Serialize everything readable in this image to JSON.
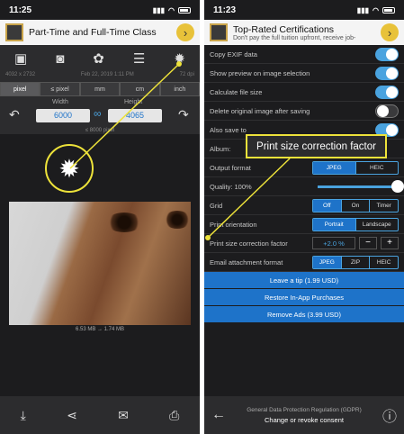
{
  "left": {
    "status": {
      "time": "11:25"
    },
    "ad": {
      "title": "Part-Time and Full-Time Class",
      "go": "›"
    },
    "toolbar": [
      "photos-icon",
      "camera-icon",
      "palette-icon",
      "sliders-icon",
      "gear-icon"
    ],
    "info": {
      "dims": "4032 x 2732",
      "date": "Feb 22, 2019 1:11 PM",
      "dpi": "72 dpi"
    },
    "units": [
      "pixel",
      "≤ pixel",
      "mm",
      "cm",
      "inch"
    ],
    "selected_unit": "pixel",
    "width_label": "Width",
    "height_label": "Height",
    "width_value": "6000",
    "height_value": "4065",
    "max_note": "≤ 8000 pixel",
    "size_info": "6.53 MB → 1.74 MB"
  },
  "right": {
    "status": {
      "time": "11:23"
    },
    "ad": {
      "title": "Top-Rated Certifications",
      "subtitle": "Don't pay the full tuition upfront, receive job-",
      "go": "›"
    },
    "rows": [
      {
        "label": "Copy EXIF data",
        "toggle": true
      },
      {
        "label": "Show preview on image selection",
        "toggle": true
      },
      {
        "label": "Calculate file size",
        "toggle": true
      },
      {
        "label": "Delete original image after saving",
        "toggle": false
      },
      {
        "label": "Also save to",
        "toggle": true
      },
      {
        "label": "Album:"
      }
    ],
    "output_format": {
      "label": "Output format",
      "options": [
        "JPEG",
        "HEIC"
      ],
      "selected": "JPEG"
    },
    "quality": {
      "label": "Quality: 100%",
      "value": 1.0
    },
    "grid": {
      "label": "Grid",
      "options": [
        "Off",
        "On",
        "Timer"
      ],
      "selected": "Off"
    },
    "print_orientation": {
      "label": "Print orientation",
      "options": [
        "Portrait",
        "Landscape"
      ],
      "selected": "Portrait"
    },
    "print_correction": {
      "label": "Print size correction factor",
      "value": "+2.0 %",
      "minus": "−",
      "plus": "+"
    },
    "email_format": {
      "label": "Email attachment format",
      "options": [
        "JPEG",
        "ZIP",
        "HEIC"
      ],
      "selected": "JPEG"
    },
    "buttons": [
      "Leave a tip (1.99 USD)",
      "Restore In-App Purchases",
      "Remove Ads (3.99 USD)"
    ],
    "gdpr": {
      "title": "General Data Protection Regulation (GDPR)",
      "action": "Change or revoke consent"
    }
  },
  "callout": {
    "text": "Print size correction factor"
  },
  "colors": {
    "accent": "#1e73c9",
    "highlight": "#ede23a",
    "bg": "#1c1c1e"
  }
}
